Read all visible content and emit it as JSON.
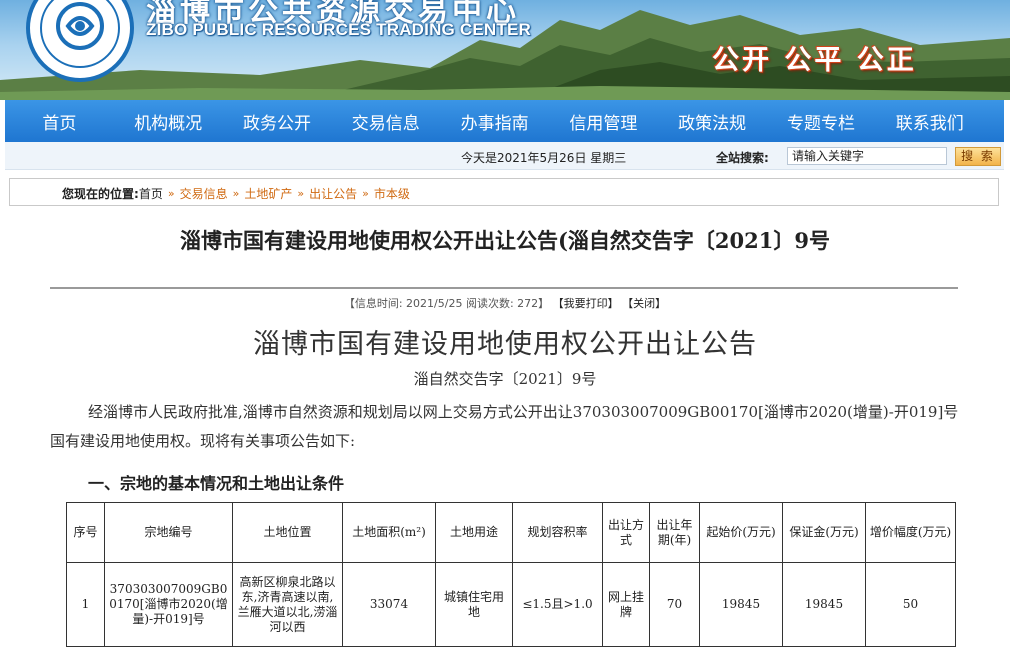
{
  "header": {
    "title_cn": "淄博市公共资源交易中心",
    "title_en": "ZIBO PUBLIC RESOURCES TRADING CENTER",
    "slogan": "公开  公平  公正",
    "colors": {
      "nav": "#2a86dc",
      "slogan_outline": "#d2431b"
    }
  },
  "nav": {
    "items": [
      "首页",
      "机构概况",
      "政务公开",
      "交易信息",
      "办事指南",
      "信用管理",
      "政策法规",
      "专题专栏",
      "联系我们"
    ]
  },
  "infobar": {
    "date_text": "今天是2021年5月26日  星期三",
    "search_label": "全站搜索:",
    "search_placeholder": "请输入关键字",
    "search_button": "搜 索"
  },
  "breadcrumb": {
    "label": "您现在的位置:",
    "items": [
      "首页",
      "交易信息",
      "土地矿产",
      "出让公告",
      "市本级"
    ],
    "separator": "»"
  },
  "article": {
    "doc_title": "淄博市国有建设用地使用权公开出让公告(淄自然交告字〔2021〕9号",
    "meta": {
      "time": "【信息时间: 2021/5/25",
      "views": "阅读次数: 272】",
      "print": "【我要打印】",
      "close": "【关闭】"
    },
    "main_title": "淄博市国有建设用地使用权公开出让公告",
    "sub_title": "淄自然交告字〔2021〕9号",
    "paragraph": "经淄博市人民政府批准,淄博市自然资源和规划局以网上交易方式公开出让370303007009GB00170[淄博市2020(增量)-开019]号国有建设用地使用权。现将有关事项公告如下:",
    "section_heading": "一、宗地的基本情况和土地出让条件"
  },
  "table": {
    "headers": [
      "序号",
      "宗地编号",
      "土地位置",
      "土地面积(m²)",
      "土地用途",
      "规划容积率",
      "出让方式",
      "出让年期(年)",
      "起始价(万元)",
      "保证金(万元)",
      "增价幅度(万元)"
    ],
    "rows": [
      [
        "1",
        "370303007009GB00170[淄博市2020(增量)-开019]号",
        "高新区柳泉北路以东,济青高速以南,兰雁大道以北,涝淄河以西",
        "33074",
        "城镇住宅用地",
        "≤1.5且>1.0",
        "网上挂牌",
        "70",
        "19845",
        "19845",
        "50"
      ]
    ]
  }
}
